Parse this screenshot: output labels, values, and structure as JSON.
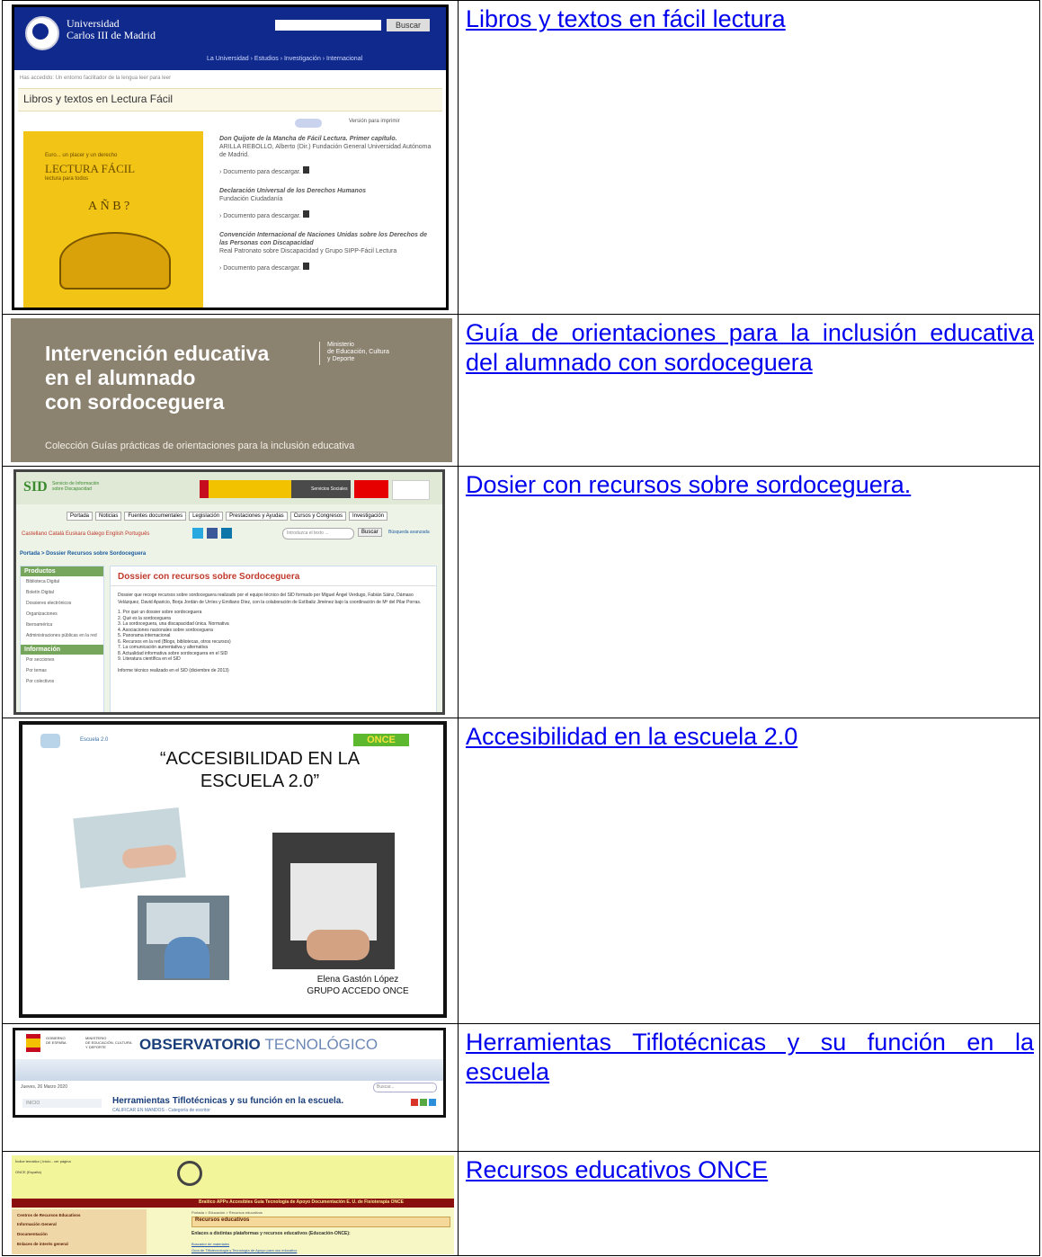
{
  "rows": [
    {
      "link": "Libros y textos en fácil lectura",
      "shot": {
        "uni_name1": "Universidad",
        "uni_name2": "Carlos III de Madrid",
        "search_btn": "Buscar",
        "nav": "La Universidad  ›  Estudios  ›  Investigación  ›  Internacional",
        "breadcrumb": "Has accedido: Un entorno facilitador de la lengua leer para leer",
        "page_title": "Libros y textos en Lectura Fácil",
        "print_link": "Versión para imprimir",
        "cover_top": "Euro... un placer y un derecho",
        "cover_title": "LECTURA FÁCIL",
        "cover_sub": "lectura para todos",
        "items": [
          {
            "title": "Don Quijote de la Mancha de Fácil Lectura. Primer capítulo.",
            "author": "ARILLA REBOLLO, Alberto (Dir.) Fundación General Universidad Autónoma de Madrid.",
            "dl": "Documento para descargar."
          },
          {
            "title": "Declaración Universal de los Derechos Humanos",
            "author": "Fundación Ciudadanía",
            "dl": "Documento para descargar."
          },
          {
            "title": "Convención Internacional de Naciones Unidas sobre los Derechos de las Personas con Discapacidad",
            "author": "Real Patronato sobre Discapacidad y Grupo SIPP-Fácil Lectura",
            "dl": "Documento para descargar."
          }
        ]
      }
    },
    {
      "link": "Guía de orientaciones para la inclusión educativa del alumnado con sordoceguera",
      "shot": {
        "title_l1": "Intervención educativa",
        "title_l2": "en el alumnado",
        "title_l3": "con sordoceguera",
        "ministry_l1": "Ministerio",
        "ministry_l2": "de Educación, Cultura",
        "ministry_l3": "y Deporte",
        "collection": "Colección Guías prácticas de orientaciones para la inclusión educativa"
      }
    },
    {
      "link": "Dosier con recursos sobre sordoceguera.",
      "shot": {
        "logo_sid": "SID",
        "logo_text": "Servicio de Información sobre Discapacidad",
        "sponsor1": "Servicios Sociales",
        "nav": [
          "Portada",
          "Noticias",
          "Fuentes documentales",
          "Legislación",
          "Prestaciones y Ayudas",
          "Cursos y Congresos",
          "Investigación"
        ],
        "langs": "Castellano  Català  Euskara  Galego  English  Português",
        "search_placeholder": "Introduzca el texto ...",
        "search_btn": "Buscar",
        "adv": "Búsqueda avanzada",
        "breadcrumb": "Portada > Dossier Recursos sobre Sordoceguera",
        "side_h1": "Productos",
        "side_items1": [
          "Biblioteca Digital",
          "Boletín Digital",
          "Dossieres electrónicos",
          "Organizaciones",
          "Iberoamérica",
          "Administraciones públicas en la red"
        ],
        "side_h2": "Información",
        "side_items2": [
          "Por secciones",
          "Por temas",
          "Por colectivos"
        ],
        "heading": "Dossier con recursos sobre Sordoceguera",
        "intro": "Dossier que recoge recursos sobre sordoceguera realizado por el equipo técnico del SID formado por Miguel Ángel Verdugo, Fabián Sáinz, Dámaso Velázquez, David Aparicio, Borja Jordán de Urríes y Emiliano Díez, con la colaboración de Estíbaliz Jiménez bajo la coordinación de Mª del Pilar Porras.",
        "list": [
          "1.  Por qué un dossier sobre sordoceguera",
          "2.  Qué es la sordoceguera",
          "3.  La sordoceguera, una discapacidad única. Normativa",
          "4.  Asociaciones nacionales sobre sordoceguera",
          "5.  Panorama internacional",
          "6.  Recursos en la red (Blogs, bibliotecas, otros recursos)",
          "7.  La comunicación aumentativa y alternativa",
          "8.  Actualidad informativa sobre sordoceguera en el SID",
          "9.  Literatura científica en el SID"
        ],
        "footer": "Informe técnico realizado en el SID (diciembre de 2013)"
      }
    },
    {
      "link": "Accesibilidad en la escuela 2.0",
      "shot": {
        "top_left": "Escuela 2.0",
        "once": "ONCE",
        "title_l1": "“ACCESIBILIDAD EN LA",
        "title_l2": "ESCUELA 2.0”",
        "author": "Elena Gastón López",
        "group": "GRUPO ACCEDO ONCE"
      }
    },
    {
      "link": "Herramientas Tiflotécnicas y su función en la escuela",
      "shot": {
        "gov1": "GOBIERNO",
        "gov2": "DE ESPAÑA",
        "min1": "MINISTERIO",
        "min2": "DE EDUCACIÓN, CULTURA",
        "min3": "Y DEPORTE",
        "obs1": "OBSERVATORIO",
        "obs2": "TECNOLÓGICO",
        "date": "Jueves, 26 Marzo 2020",
        "search": "Buscar...",
        "side": "INICIO",
        "heading": "Herramientas Tiflotécnicas y su función en la escuela.",
        "sub": "CALIFICAR EN MANDOS - Categoría de escritor"
      }
    },
    {
      "link": "Recursos educativos ONCE",
      "shot": {
        "top_links": "Índice temático | Inicio - ver página",
        "logo": "ONCE (España)",
        "nav": "Braitico   APPs Accesibles   Guía Tecnología de Apoyo   Documentación   E. U. de Fisioterapia ONCE",
        "side": [
          "Centros de Recursos Educativos",
          "Información General",
          "Documentación",
          "Enlaces de interés general"
        ],
        "breadcrumb": "Portada > Educación > Recursos educativos",
        "heading": "Recursos educativos",
        "sub": "Enlaces a distintas plataformas y recursos educativos (Educación-ONCE):",
        "link1": "Buscador de materiales",
        "link2": "Guía de Tiflotecnología y Tecnología de Apoyo para uso educativo"
      }
    }
  ]
}
